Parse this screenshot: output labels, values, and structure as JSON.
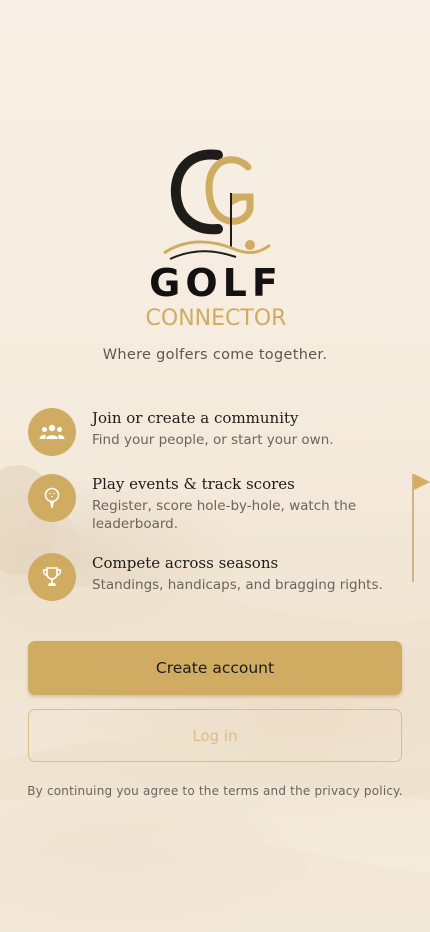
{
  "brand": {
    "name_line1": "GOLF",
    "name_line2": "CONNECTOR",
    "monogram": "CG",
    "tagline": "Where golfers come together."
  },
  "features": [
    {
      "icon": "people-group-icon",
      "title": "Join or create a community",
      "description": "Find your people, or start your own."
    },
    {
      "icon": "golf-ball-tee-icon",
      "title": "Play events & track scores",
      "description": "Register, score hole-by-hole, watch the leaderboard."
    },
    {
      "icon": "trophy-icon",
      "title": "Compete across seasons",
      "description": "Standings, handicaps, and bragging rights."
    }
  ],
  "actions": {
    "create_account_label": "Create account",
    "log_in_label": "Log in"
  },
  "legal": {
    "prefix": "By continuing you agree to the ",
    "terms_label": "terms",
    "middle": " and the ",
    "privacy_label": "privacy policy",
    "suffix": "."
  },
  "colors": {
    "accent": "#cfac62",
    "background": "#f6ede0",
    "text": "#1e1c19",
    "muted_text": "#6b655e"
  }
}
